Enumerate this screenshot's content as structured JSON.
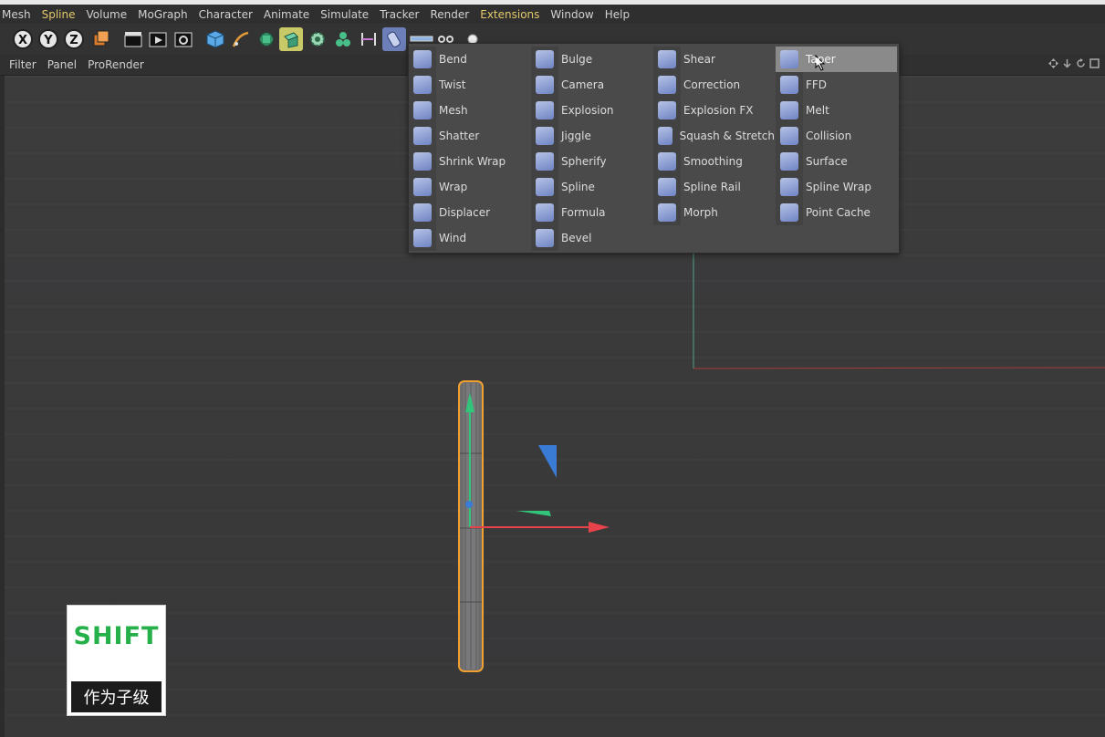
{
  "menubar": {
    "items": [
      {
        "label": "Mesh"
      },
      {
        "label": "Spline",
        "highlight": true
      },
      {
        "label": "Volume"
      },
      {
        "label": "MoGraph"
      },
      {
        "label": "Character"
      },
      {
        "label": "Animate"
      },
      {
        "label": "Simulate"
      },
      {
        "label": "Tracker"
      },
      {
        "label": "Render"
      },
      {
        "label": "Extensions",
        "highlight": true
      },
      {
        "label": "Window"
      },
      {
        "label": "Help"
      }
    ]
  },
  "toolbar": {
    "axis_x": "X",
    "axis_y": "Y",
    "axis_z": "Z"
  },
  "viewbar": {
    "items": [
      "Filter",
      "Panel",
      "ProRender"
    ]
  },
  "deformer_menu": {
    "columns": [
      [
        {
          "label": "Bend",
          "icon": "bend-icon"
        },
        {
          "label": "Twist",
          "icon": "twist-icon"
        },
        {
          "label": "Mesh",
          "icon": "mesh-deformer-icon"
        },
        {
          "label": "Shatter",
          "icon": "shatter-icon"
        },
        {
          "label": "Shrink Wrap",
          "icon": "shrink-wrap-icon"
        },
        {
          "label": "Wrap",
          "icon": "wrap-icon"
        },
        {
          "label": "Displacer",
          "icon": "displacer-icon"
        },
        {
          "label": "Wind",
          "icon": "wind-icon"
        }
      ],
      [
        {
          "label": "Bulge",
          "icon": "bulge-icon"
        },
        {
          "label": "Camera",
          "icon": "camera-icon"
        },
        {
          "label": "Explosion",
          "icon": "explosion-icon"
        },
        {
          "label": "Jiggle",
          "icon": "jiggle-icon"
        },
        {
          "label": "Spherify",
          "icon": "spherify-icon"
        },
        {
          "label": "Spline",
          "icon": "spline-icon"
        },
        {
          "label": "Formula",
          "icon": "formula-icon"
        },
        {
          "label": "Bevel",
          "icon": "bevel-icon"
        }
      ],
      [
        {
          "label": "Shear",
          "icon": "shear-icon"
        },
        {
          "label": "Correction",
          "icon": "correction-icon"
        },
        {
          "label": "Explosion FX",
          "icon": "explosion-fx-icon"
        },
        {
          "label": "Squash & Stretch",
          "icon": "squash-stretch-icon"
        },
        {
          "label": "Smoothing",
          "icon": "smoothing-icon"
        },
        {
          "label": "Spline Rail",
          "icon": "spline-rail-icon"
        },
        {
          "label": "Morph",
          "icon": "morph-icon"
        }
      ],
      [
        {
          "label": "Taper",
          "icon": "taper-icon",
          "selected": true
        },
        {
          "label": "FFD",
          "icon": "ffd-icon"
        },
        {
          "label": "Melt",
          "icon": "melt-icon"
        },
        {
          "label": "Collision",
          "icon": "collision-icon"
        },
        {
          "label": "Surface",
          "icon": "surface-icon"
        },
        {
          "label": "Spline Wrap",
          "icon": "spline-wrap-icon"
        },
        {
          "label": "Point Cache",
          "icon": "point-cache-icon"
        }
      ]
    ]
  },
  "overlay": {
    "key": "SHIFT",
    "caption": "作为子级"
  },
  "colors": {
    "accent_yellow": "#e3c86a",
    "shift_green": "#25b04a",
    "axis_red": "#e8434a",
    "axis_green": "#31c47a",
    "axis_blue": "#3a7bd5",
    "selection_orange": "#f0a030"
  }
}
